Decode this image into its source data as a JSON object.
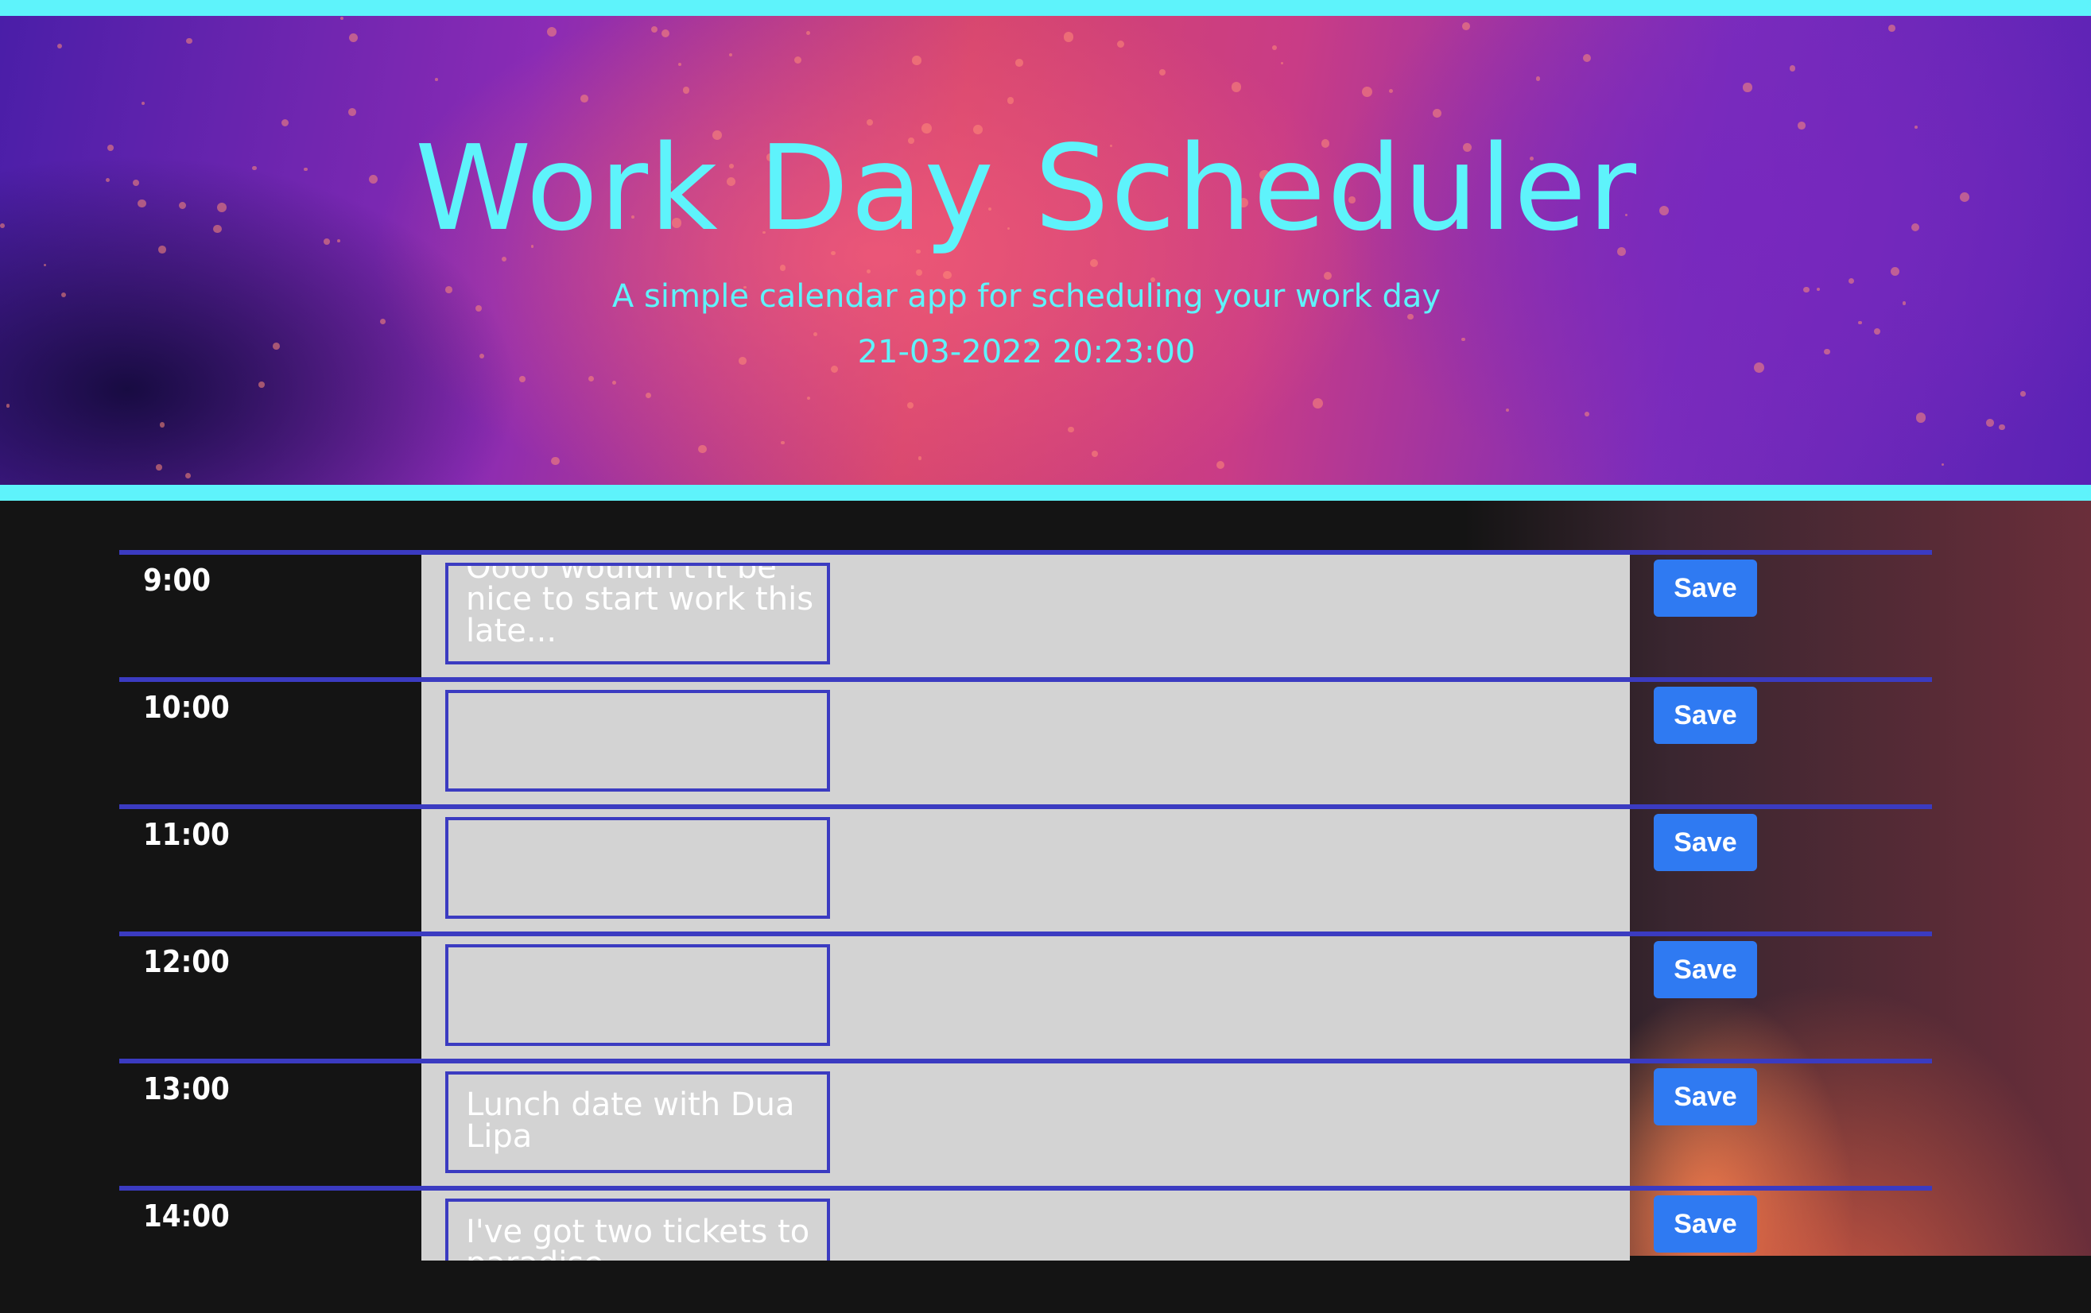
{
  "header": {
    "title": "Work Day Scheduler",
    "subtitle": "A simple calendar app for scheduling your work day",
    "datetime": "21-03-2022 20:23:00"
  },
  "rows": [
    {
      "hour": "9:00",
      "text": "Oooo wouldn't it be nice to start work this late...",
      "save_label": "Save"
    },
    {
      "hour": "10:00",
      "text": "",
      "save_label": "Save"
    },
    {
      "hour": "11:00",
      "text": "",
      "save_label": "Save"
    },
    {
      "hour": "12:00",
      "text": "",
      "save_label": "Save"
    },
    {
      "hour": "13:00",
      "text": "Lunch date with Dua Lipa",
      "save_label": "Save"
    },
    {
      "hour": "14:00",
      "text": "I've got two tickets to paradise",
      "save_label": "Save"
    }
  ],
  "colors": {
    "accent": "#5ef3fb",
    "row_border": "#3b3bc1",
    "save_button": "#2f7af2",
    "cell_gray": "#d3d3d3"
  }
}
